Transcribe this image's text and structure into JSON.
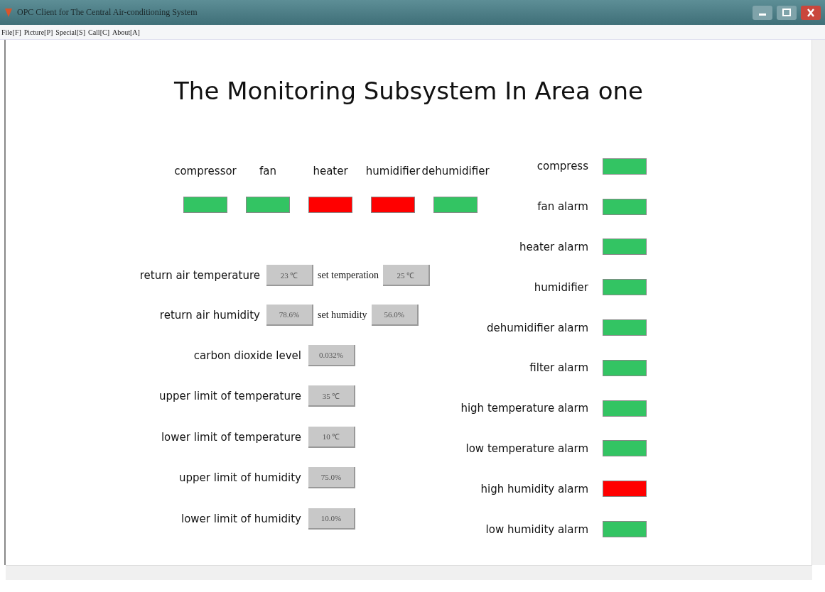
{
  "window": {
    "title": "OPC Client for The Central Air-conditioning System"
  },
  "menu": [
    "File[F]",
    "Picture[P]",
    "Special[S]",
    "Call[C]",
    "About[A]"
  ],
  "heading": "The Monitoring Subsystem In Area one",
  "devices": [
    {
      "label": "compressor",
      "on": false
    },
    {
      "label": "fan",
      "on": false
    },
    {
      "label": "heater",
      "on": true
    },
    {
      "label": "humidifier",
      "on": true
    },
    {
      "label": "dehumidifier",
      "on": false
    }
  ],
  "paired_readings": [
    {
      "label": "return air temperature",
      "value": "23 ℃",
      "set_label": "set temperation",
      "set_value": "25 ℃"
    },
    {
      "label": "return air humidity",
      "value": "78.6%",
      "set_label": "set humidity",
      "set_value": "56.0%"
    }
  ],
  "readings": [
    {
      "label": "carbon dioxide level",
      "value": "0.032%"
    },
    {
      "label": "upper limit of temperature",
      "value": "35 ℃"
    },
    {
      "label": "lower limit of temperature",
      "value": "10 ℃"
    },
    {
      "label": "upper limit of humidity",
      "value": "75.0%"
    },
    {
      "label": "lower limit of humidity",
      "value": "10.0%"
    }
  ],
  "alarms": [
    {
      "label": "compress",
      "on": false
    },
    {
      "label": "fan alarm",
      "on": false
    },
    {
      "label": "heater alarm",
      "on": false
    },
    {
      "label": "humidifier",
      "on": false
    },
    {
      "label": "dehumidifier alarm",
      "on": false
    },
    {
      "label": "filter alarm",
      "on": false
    },
    {
      "label": "high temperature alarm",
      "on": false
    },
    {
      "label": "low temperature alarm",
      "on": false
    },
    {
      "label": "high humidity alarm",
      "on": true
    },
    {
      "label": "low humidity alarm",
      "on": false
    }
  ]
}
